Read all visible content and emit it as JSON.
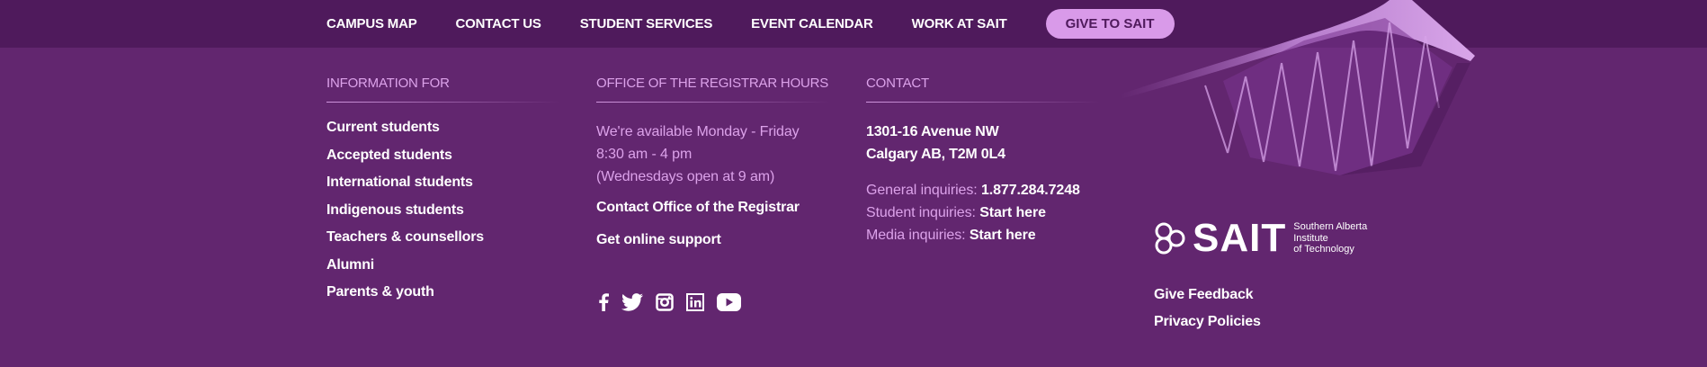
{
  "topnav": {
    "items": [
      {
        "label": "CAMPUS MAP"
      },
      {
        "label": "CONTACT US"
      },
      {
        "label": "STUDENT SERVICES"
      },
      {
        "label": "EVENT CALENDAR"
      },
      {
        "label": "WORK AT SAIT"
      }
    ],
    "give_label": "GIVE TO SAIT"
  },
  "info": {
    "heading": "INFORMATION FOR",
    "items": [
      {
        "label": "Current students"
      },
      {
        "label": "Accepted students"
      },
      {
        "label": "International students"
      },
      {
        "label": "Indigenous students"
      },
      {
        "label": "Teachers & counsellors"
      },
      {
        "label": "Alumni"
      },
      {
        "label": "Parents & youth"
      }
    ]
  },
  "registrar": {
    "heading": "OFFICE OF THE REGISTRAR HOURS",
    "line1": "We're available Monday - Friday",
    "line2": "8:30 am - 4 pm",
    "line3": "(Wednesdays open at 9 am)",
    "contact_link": "Contact Office of the Registrar",
    "support_link": "Get online support"
  },
  "social": [
    "facebook-icon",
    "twitter-icon",
    "instagram-icon",
    "linkedin-icon",
    "youtube-icon"
  ],
  "contact": {
    "heading": "CONTACT",
    "address1": "1301-16 Avenue NW",
    "address2": "Calgary AB, T2M 0L4",
    "general_label": "General inquiries:",
    "general_value": "1.877.284.7248",
    "student_label": "Student inquiries:",
    "student_value": "Start here",
    "media_label": "Media inquiries:",
    "media_value": "Start here"
  },
  "logo": {
    "word": "SAIT",
    "sub1": "Southern Alberta",
    "sub2": "Institute",
    "sub3": "of Technology"
  },
  "footer_links": {
    "feedback": "Give Feedback",
    "privacy": "Privacy Policies"
  },
  "colors": {
    "background": "#62266f",
    "topbar": "#4f1a5c",
    "accent": "#dca2ea",
    "button": "#d99ae9"
  }
}
